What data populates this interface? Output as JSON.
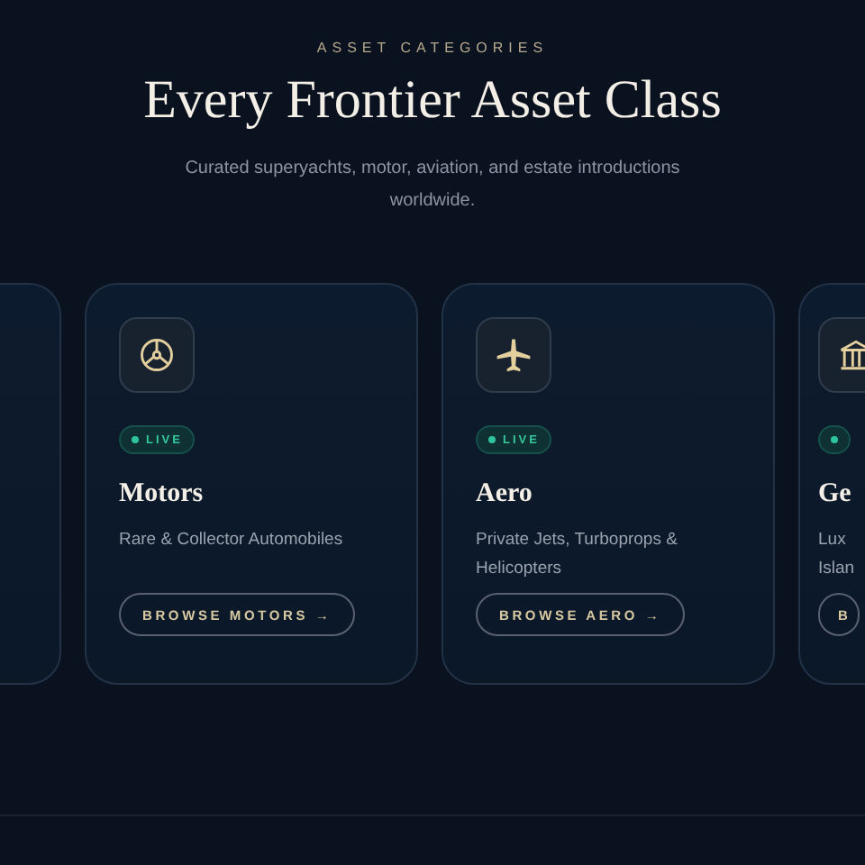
{
  "eyebrow": "ASSET CATEGORIES",
  "title": "Every Frontier Asset Class",
  "subtitle": "Curated superyachts, motor, aviation, and estate introductions worldwide.",
  "cards": [
    {
      "kind": "hidden"
    },
    {
      "kind": "full",
      "badge": {
        "live": true,
        "label": "LIVE"
      },
      "title": "Motors",
      "description_lines": [
        "Rare & Collector Automobiles"
      ],
      "button": "BROWSE MOTORS →"
    },
    {
      "kind": "full",
      "badge": {
        "live": true,
        "label": "LIVE"
      },
      "title": "Aero",
      "description_lines": [
        "Private Jets, Turboprops &",
        "Helicopters"
      ],
      "button": "BROWSE AERO →"
    },
    {
      "kind": "clipped",
      "badge": {
        "live": true
      },
      "title": "Ge",
      "description_lines": [
        "Lux",
        "Islan"
      ],
      "button": "B"
    }
  ]
}
